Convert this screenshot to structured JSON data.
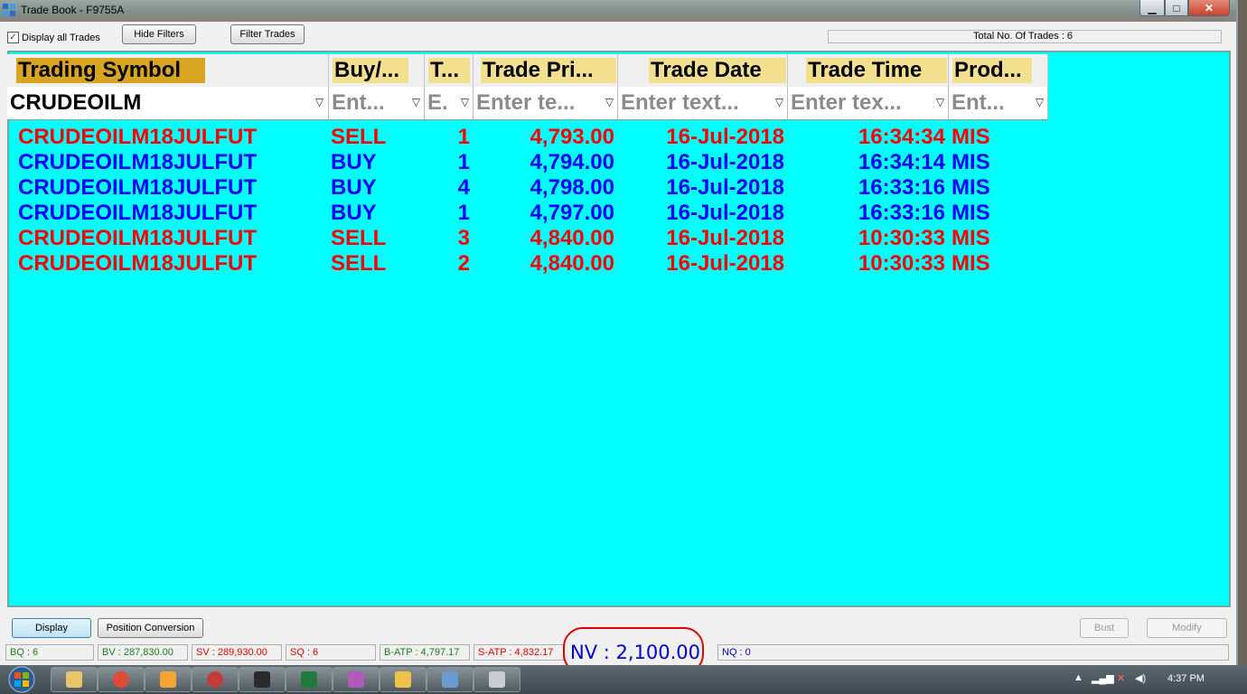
{
  "window": {
    "title": "Trade Book - F9755A",
    "min_label": "▁",
    "max_label": "□",
    "close_label": "✕"
  },
  "toolbar": {
    "display_all_label": "Display all Trades",
    "display_all_checked": true,
    "hide_filters_label": "Hide Filters",
    "filter_trades_label": "Filter Trades",
    "total_trades_label": "Total No. Of Trades : 6"
  },
  "grid": {
    "columns": [
      {
        "label": "Trading Symbol",
        "header_color": "#d9a520"
      },
      {
        "label": "Buy/...",
        "header_color": "#f3e08f"
      },
      {
        "label": "T...",
        "header_color": "#f3e08f"
      },
      {
        "label": "Trade Pri...",
        "header_color": "#f3e08f"
      },
      {
        "label": "Trade Date",
        "header_color": "#f3e08f"
      },
      {
        "label": "Trade Time",
        "header_color": "#f3e08f"
      },
      {
        "label": "Prod...",
        "header_color": "#f3e08f"
      }
    ],
    "filters": [
      "CRUDEOILM",
      "Ent...",
      "E.",
      "Enter te...",
      "Enter text...",
      "Enter tex...",
      "Ent..."
    ],
    "background": "#00ffff",
    "rows": [
      {
        "symbol": "CRUDEOILM18JULFUT",
        "side": "SELL",
        "qty": "1",
        "price": "4,793.00",
        "date": "16-Jul-2018",
        "time": "16:34:34",
        "product": "MIS",
        "color": "#ff0000"
      },
      {
        "symbol": "CRUDEOILM18JULFUT",
        "side": "BUY",
        "qty": "1",
        "price": "4,794.00",
        "date": "16-Jul-2018",
        "time": "16:34:14",
        "product": "MIS",
        "color": "#0000ff"
      },
      {
        "symbol": "CRUDEOILM18JULFUT",
        "side": "BUY",
        "qty": "4",
        "price": "4,798.00",
        "date": "16-Jul-2018",
        "time": "16:33:16",
        "product": "MIS",
        "color": "#0000ff"
      },
      {
        "symbol": "CRUDEOILM18JULFUT",
        "side": "BUY",
        "qty": "1",
        "price": "4,797.00",
        "date": "16-Jul-2018",
        "time": "16:33:16",
        "product": "MIS",
        "color": "#0000ff"
      },
      {
        "symbol": "CRUDEOILM18JULFUT",
        "side": "SELL",
        "qty": "3",
        "price": "4,840.00",
        "date": "16-Jul-2018",
        "time": "10:30:33",
        "product": "MIS",
        "color": "#ff0000"
      },
      {
        "symbol": "CRUDEOILM18JULFUT",
        "side": "SELL",
        "qty": "2",
        "price": "4,840.00",
        "date": "16-Jul-2018",
        "time": "10:30:33",
        "product": "MIS",
        "color": "#ff0000"
      }
    ]
  },
  "actions": {
    "display_label": "Display",
    "position_conversion_label": "Position Conversion",
    "bust_label": "Bust",
    "modify_label": "Modify"
  },
  "status": {
    "bq": "BQ : 6",
    "bv": "BV : 287,830.00",
    "sv": "SV : 289,930.00",
    "sq": "SQ : 6",
    "batp": "B-ATP : 4,797.17",
    "satp": "S-ATP : 4,832.17",
    "nv": "NV : 2,100.00",
    "nq": "NQ : 0"
  },
  "taskbar": {
    "clock": "4:37 PM",
    "icons": [
      "file-explorer-icon",
      "chrome-icon",
      "media-player-icon",
      "app-icon",
      "trading-terminal-icon",
      "excel-icon",
      "app-icon-2",
      "folder-icon",
      "window-icon",
      "calculator-icon"
    ]
  }
}
